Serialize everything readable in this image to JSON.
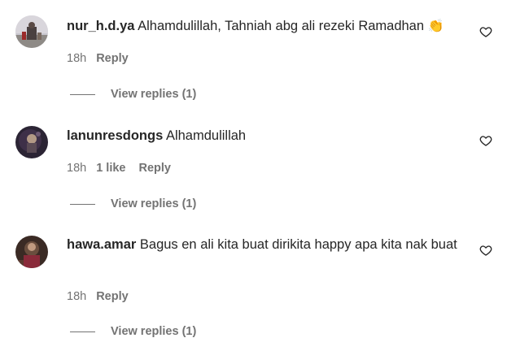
{
  "comments": [
    {
      "username": "nur_h.d.ya",
      "text": "Alhamdulillah, Tahniah abg ali rezeki Ramadhan",
      "emoji": "👏",
      "time": "18h",
      "likes": "",
      "reply_label": "Reply",
      "view_replies": "View replies (1)"
    },
    {
      "username": "lanunresdongs",
      "text": "Alhamdulillah",
      "time": "18h",
      "likes": "1 like",
      "reply_label": "Reply",
      "view_replies": "View replies (1)"
    },
    {
      "username": "hawa.amar",
      "text": "Bagus en ali kita buat dirikita happy apa kita nak buat",
      "time": "18h",
      "likes": "",
      "reply_label": "Reply",
      "view_replies": "View replies (1)"
    }
  ],
  "colors": {
    "text": "#262626",
    "secondary": "#737373"
  },
  "icons": {
    "like": "heart-outline-icon",
    "clap": "clapping-hands-emoji"
  }
}
